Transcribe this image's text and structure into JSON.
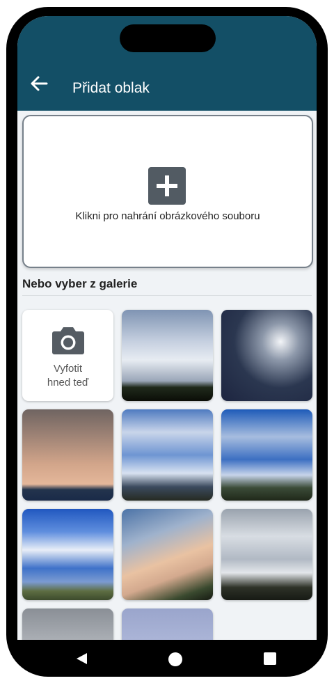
{
  "header": {
    "title": "Přidat oblak"
  },
  "upload": {
    "label": "Klikni pro nahrání obrázkového souboru"
  },
  "gallery": {
    "title": "Nebo vyber z galerie",
    "camera_line1": "Vyfotit",
    "camera_line2": "hned teď"
  },
  "colors": {
    "app_bar": "#134f66",
    "background": "#f0f3f6"
  },
  "icons": [
    "back-arrow-icon",
    "plus-icon",
    "camera-icon",
    "nav-back-icon",
    "nav-home-icon",
    "nav-recents-icon"
  ]
}
